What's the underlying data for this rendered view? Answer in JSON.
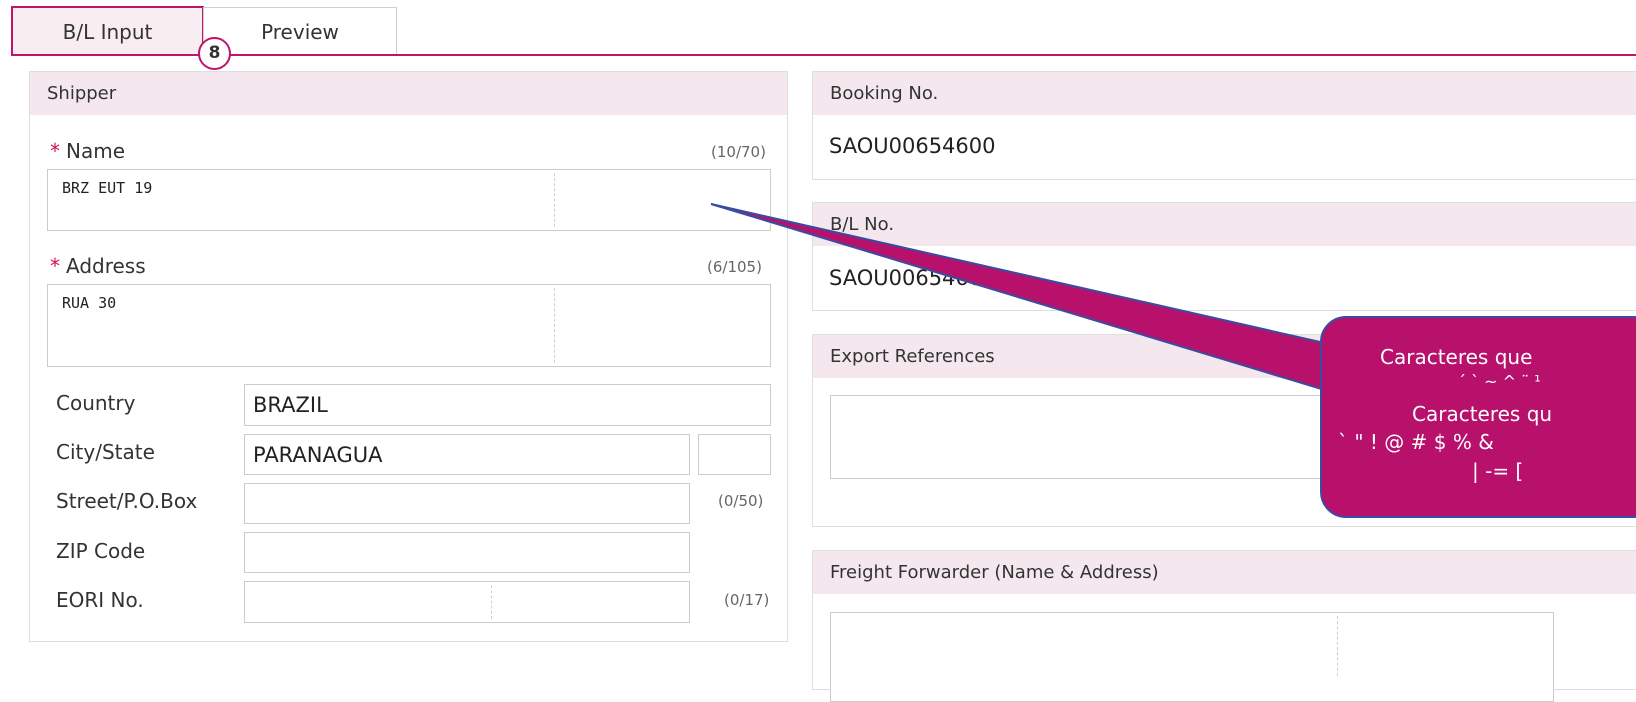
{
  "tabs": {
    "bl_input": "B/L Input",
    "preview": "Preview",
    "badge": "8"
  },
  "shipper": {
    "title": "Shipper",
    "name_label": "Name",
    "name_counter": "(10/70)",
    "name_value": "BRZ EUT 19",
    "address_label": "Address",
    "address_counter": "(6/105)",
    "address_value": "RUA 30",
    "country_label": "Country",
    "country_value": "BRAZIL",
    "city_label": "City/State",
    "city_value": "PARANAGUA",
    "street_label": "Street/P.O.Box",
    "street_counter": "(0/50)",
    "zip_label": "ZIP Code",
    "eori_label": "EORI No.",
    "eori_counter": "(0/17)"
  },
  "booking": {
    "title": "Booking No.",
    "value": "SAOU00654600"
  },
  "bl": {
    "title": "B/L No.",
    "value": "SAOU00654600"
  },
  "export_refs": {
    "title": "Export References"
  },
  "forwarder": {
    "title": "Freight Forwarder (Name & Address)"
  },
  "callout": {
    "line1": "Caracteres que",
    "line2": "´ ` ~ ^ ¨ ¹",
    "line3": "Caracteres qu",
    "line4": "` \" ! @ # $ % &",
    "line5": "| -= ["
  },
  "colors": {
    "accent": "#c0136e",
    "callout": "#b8116c",
    "panel_header": "#f4e8ee"
  }
}
